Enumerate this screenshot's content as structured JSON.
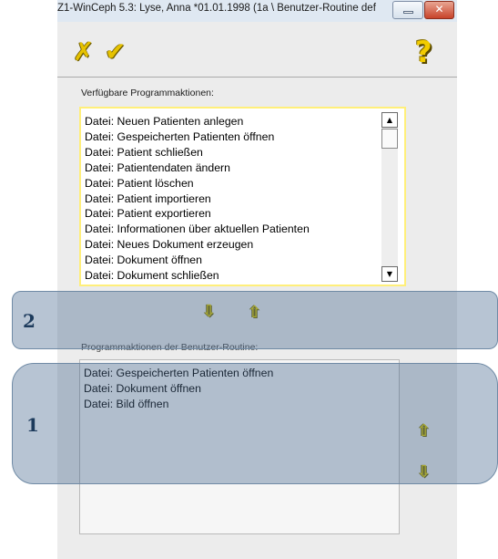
{
  "window": {
    "title": "Z1-WinCeph 5.3: Lyse, Anna *01.01.1998 (1a \\ Benutzer-Routine def",
    "close_glyph": "✕"
  },
  "toolbar": {
    "cancel_glyph": "✗",
    "ok_glyph": "✔",
    "help_glyph": "?"
  },
  "available": {
    "label": "Verfügbare Programmaktionen:",
    "items": [
      "Datei: Neuen Patienten anlegen",
      "Datei: Gespeicherten Patienten öffnen",
      "Datei: Patient schließen",
      "Datei: Patientendaten ändern",
      "Datei: Patient löschen",
      "Datei: Patient importieren",
      "Datei: Patient exportieren",
      "Datei: Informationen über aktuellen Patienten",
      "Datei: Neues Dokument erzeugen",
      "Datei: Dokument öffnen",
      "Datei: Dokument schließen"
    ],
    "scroll_up_glyph": "▲",
    "scroll_down_glyph": "▼"
  },
  "transfer": {
    "add_glyph": "⇩",
    "remove_glyph": "⇧"
  },
  "routine": {
    "label": "Programmaktionen der Benutzer-Routine:",
    "items": [
      "Datei: Gespeicherten Patienten öffnen",
      "Datei: Dokument öffnen",
      "Datei: Bild öffnen"
    ],
    "move_up_glyph": "⇧",
    "move_down_glyph": "⇩"
  },
  "annotations": {
    "box_2_number": "2",
    "box_1_number": "1",
    "color": "#42648c"
  }
}
